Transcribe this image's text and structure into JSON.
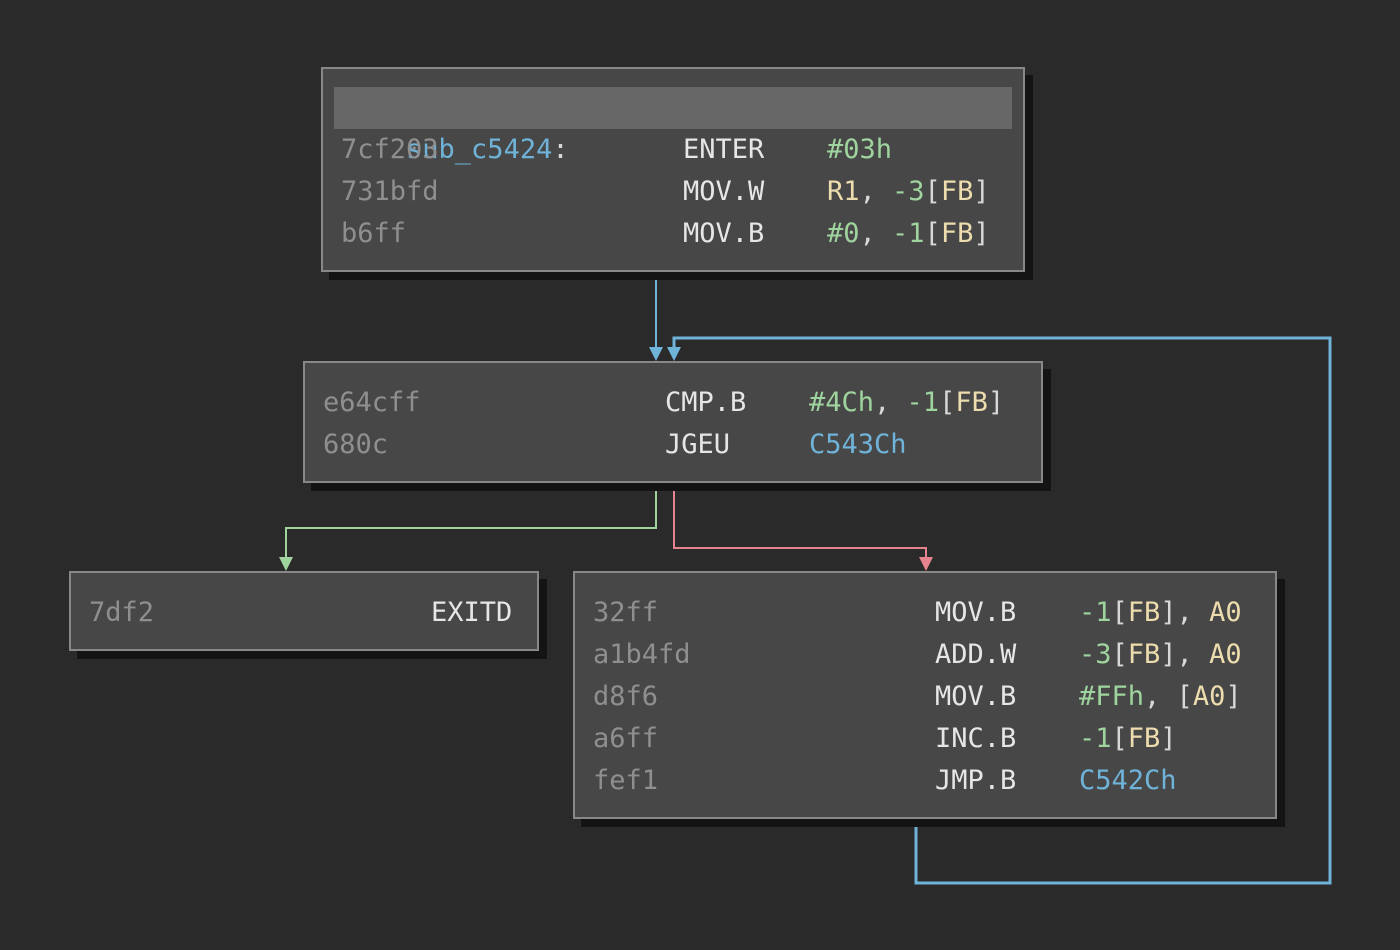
{
  "colors": {
    "background": "#2a2a2a",
    "block_fill": "#474747",
    "block_border": "#888888",
    "edge_unconditional": "#6fb3d9",
    "edge_true": "#9fd49e",
    "edge_false": "#e5838f"
  },
  "blocks": {
    "entry": {
      "label": "sub_c5424",
      "label_colon": ":",
      "rows": [
        {
          "addr": "7cf203",
          "mnemonic": "ENTER",
          "ops": [
            {
              "t": "#03h",
              "k": "num"
            }
          ]
        },
        {
          "addr": "731bfd",
          "mnemonic": "MOV.W",
          "ops": [
            {
              "t": "R1",
              "k": "reg"
            },
            {
              "t": ", ",
              "k": "pun"
            },
            {
              "t": "-3",
              "k": "num"
            },
            {
              "t": "[",
              "k": "pun"
            },
            {
              "t": "FB",
              "k": "reg"
            },
            {
              "t": "]",
              "k": "pun"
            }
          ]
        },
        {
          "addr": "b6ff",
          "mnemonic": "MOV.B",
          "ops": [
            {
              "t": "#0",
              "k": "num"
            },
            {
              "t": ", ",
              "k": "pun"
            },
            {
              "t": "-1",
              "k": "num"
            },
            {
              "t": "[",
              "k": "pun"
            },
            {
              "t": "FB",
              "k": "reg"
            },
            {
              "t": "]",
              "k": "pun"
            }
          ]
        }
      ]
    },
    "cond": {
      "rows": [
        {
          "addr": "e64cff",
          "mnemonic": "CMP.B",
          "ops": [
            {
              "t": "#4Ch",
              "k": "num"
            },
            {
              "t": ", ",
              "k": "pun"
            },
            {
              "t": "-1",
              "k": "num"
            },
            {
              "t": "[",
              "k": "pun"
            },
            {
              "t": "FB",
              "k": "reg"
            },
            {
              "t": "]",
              "k": "pun"
            }
          ]
        },
        {
          "addr": "680c",
          "mnemonic": "JGEU",
          "ops": [
            {
              "t": "C543Ch",
              "k": "lab"
            }
          ]
        }
      ]
    },
    "exit": {
      "rows": [
        {
          "addr": "7df2",
          "mnemonic": "EXITD",
          "ops": []
        }
      ]
    },
    "loop": {
      "rows": [
        {
          "addr": "32ff",
          "mnemonic": "MOV.B",
          "ops": [
            {
              "t": "-1",
              "k": "num"
            },
            {
              "t": "[",
              "k": "pun"
            },
            {
              "t": "FB",
              "k": "reg"
            },
            {
              "t": "], ",
              "k": "pun"
            },
            {
              "t": "A0",
              "k": "reg"
            }
          ]
        },
        {
          "addr": "a1b4fd",
          "mnemonic": "ADD.W",
          "ops": [
            {
              "t": "-3",
              "k": "num"
            },
            {
              "t": "[",
              "k": "pun"
            },
            {
              "t": "FB",
              "k": "reg"
            },
            {
              "t": "], ",
              "k": "pun"
            },
            {
              "t": "A0",
              "k": "reg"
            }
          ]
        },
        {
          "addr": "d8f6",
          "mnemonic": "MOV.B",
          "ops": [
            {
              "t": "#FFh",
              "k": "num"
            },
            {
              "t": ", [",
              "k": "pun"
            },
            {
              "t": "A0",
              "k": "reg"
            },
            {
              "t": "]",
              "k": "pun"
            }
          ]
        },
        {
          "addr": "a6ff",
          "mnemonic": "INC.B",
          "ops": [
            {
              "t": "-1",
              "k": "num"
            },
            {
              "t": "[",
              "k": "pun"
            },
            {
              "t": "FB",
              "k": "reg"
            },
            {
              "t": "]",
              "k": "pun"
            }
          ]
        },
        {
          "addr": "fef1",
          "mnemonic": "JMP.B",
          "ops": [
            {
              "t": "C542Ch",
              "k": "lab"
            }
          ]
        }
      ]
    }
  }
}
